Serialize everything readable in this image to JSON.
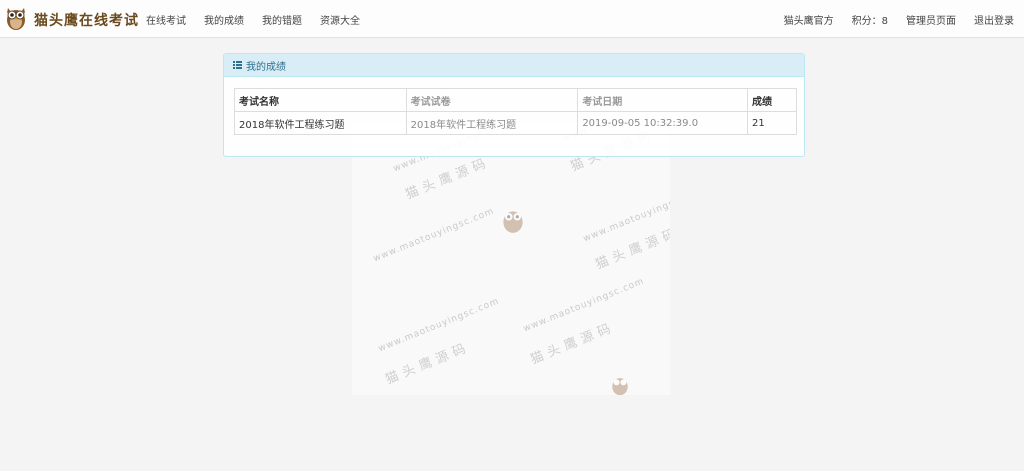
{
  "brand": {
    "title": "猫头鹰在线考试",
    "logo_icon": "owl-logo-icon"
  },
  "nav": {
    "left": [
      "在线考试",
      "我的成绩",
      "我的错题",
      "资源大全"
    ],
    "right": {
      "official": "猫头鹰官方",
      "points": "积分：8",
      "admin": "管理员页面",
      "logout": "退出登录"
    }
  },
  "panel": {
    "title": "我的成绩",
    "icon": "list-icon",
    "table": {
      "headers": [
        "考试名称",
        "考试试卷",
        "考试日期",
        "成绩"
      ],
      "rows": [
        [
          "2018年软件工程练习题",
          "2018年软件工程练习题",
          "2019-09-05 10:32:39.0",
          "21"
        ]
      ]
    }
  },
  "watermark": {
    "url": "www.maotouyingsc.com",
    "text": "猫头鹰源码"
  },
  "colors": {
    "panel_heading_bg": "#d9edf7",
    "panel_heading_text": "#31708f",
    "panel_border": "#bce8f1",
    "page_bg": "#f4f4f4"
  }
}
